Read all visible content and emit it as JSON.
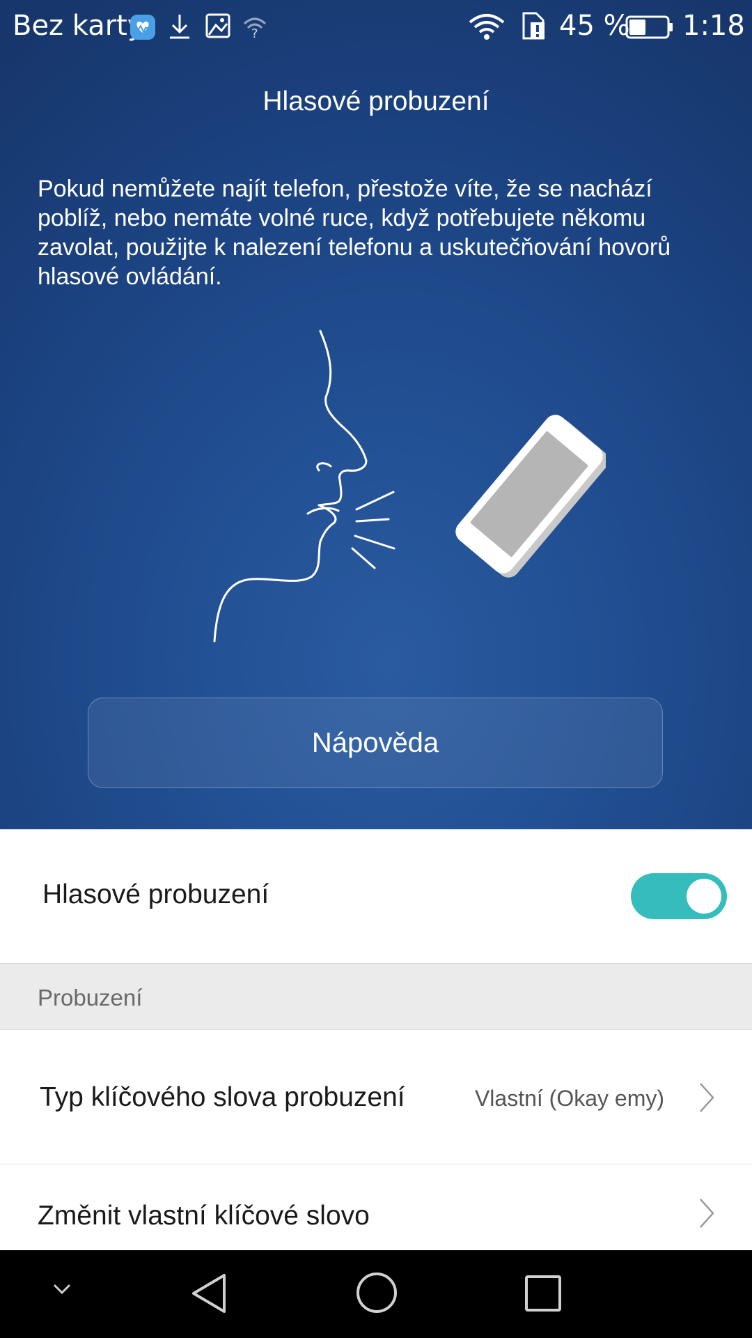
{
  "status_bar": {
    "carrier": "Bez karty",
    "battery_percent": "45 %",
    "time": "1:18",
    "icons": [
      "health-icon",
      "download-icon",
      "gallery-icon",
      "wifi-question-icon",
      "wifi-icon",
      "sim-alert-icon",
      "battery-icon"
    ],
    "battery_level": 0.45
  },
  "header": {
    "title": "Hlasové probuzení",
    "description": "Pokud nemůžete najít telefon, přestože víte, že se nachází poblíž, nebo nemáte volné ruce, když potřebujete někomu zavolat, použijte k nalezení telefonu a uskutečňování hovorů hlasové ovládání.",
    "help_button": "Nápověda"
  },
  "settings": {
    "voice_wakeup_label": "Hlasové probuzení",
    "voice_wakeup_enabled": true,
    "section_title": "Probuzení",
    "rows": [
      {
        "label": "Typ klíčového slova probuzení",
        "value": "Vlastní (Okay emy)"
      },
      {
        "label": "Změnit vlastní klíčové slovo"
      }
    ]
  },
  "colors": {
    "header_blue": "#1f4b8e",
    "toggle_on": "#35bdbd",
    "section_bg": "#ebebeb"
  },
  "navbar": {
    "icons": [
      "chevron-down-icon",
      "back-icon",
      "home-icon",
      "recents-icon"
    ]
  }
}
